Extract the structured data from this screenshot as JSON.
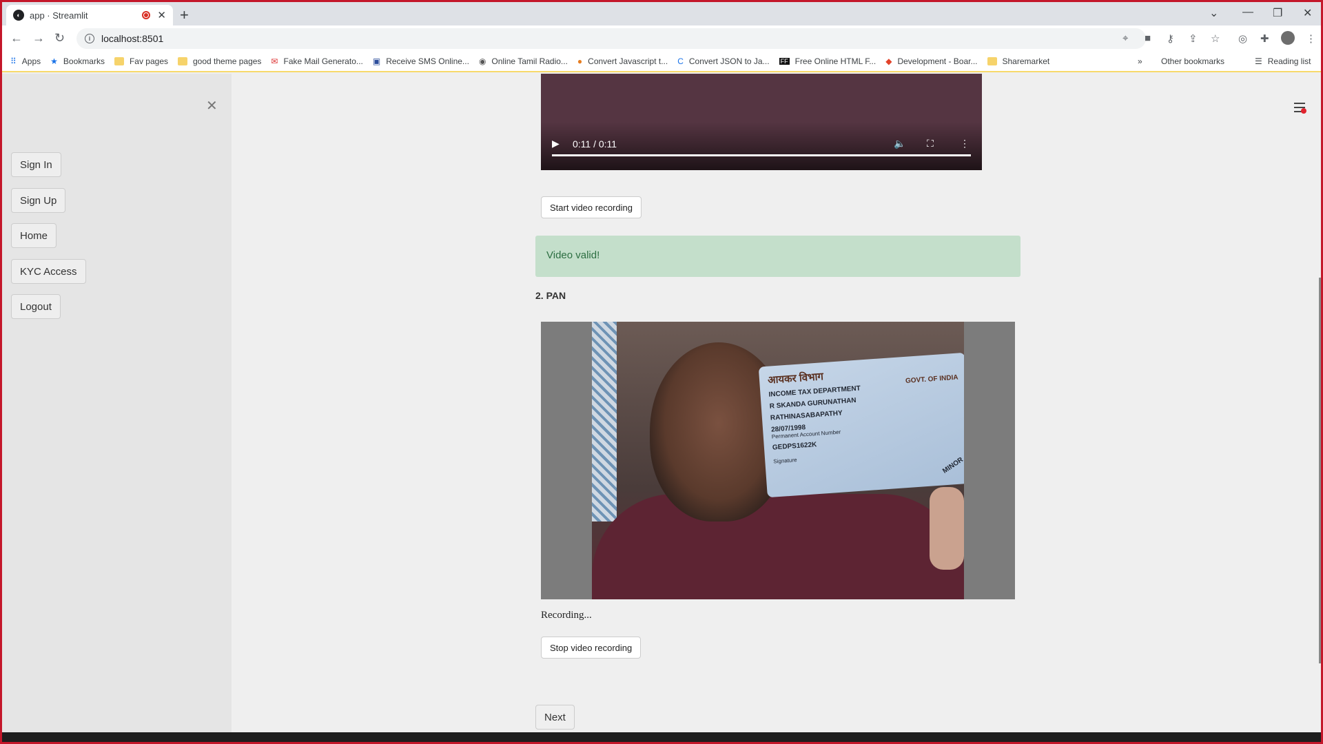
{
  "browser": {
    "tab_title": "app · Streamlit",
    "url": "localhost:8501",
    "bookmarks": [
      "Apps",
      "Bookmarks",
      "Fav pages",
      "good theme pages",
      "Fake Mail Generato...",
      "Receive SMS Online...",
      "Online Tamil Radio...",
      "Convert Javascript t...",
      "Convert JSON to Ja...",
      "Free Online HTML F...",
      "Development - Boar...",
      "Sharemarket"
    ],
    "bookmarks_overflow": "»",
    "other_bookmarks": "Other bookmarks",
    "reading_list": "Reading list"
  },
  "sidebar": {
    "close_glyph": "✕",
    "items": [
      "Sign In",
      "Sign Up",
      "Home",
      "KYC Access",
      "Logout"
    ]
  },
  "video_player": {
    "time": "0:11 / 0:11",
    "progress": 1.0
  },
  "main": {
    "start_button": "Start video recording",
    "success_message": "Video valid!",
    "section_title": "2. PAN",
    "recording_status": "Recording...",
    "stop_button": "Stop video recording",
    "next_button": "Next"
  },
  "pan_card": {
    "header_hindi": "आयकर विभाग",
    "header": "INCOME TAX DEPARTMENT",
    "govt": "GOVT. OF INDIA",
    "name": "R SKANDA GURUNATHAN",
    "father_name": "RATHINASABAPATHY",
    "dob": "28/07/1998",
    "pan_label": "Permanent Account Number",
    "pan_number": "GEDPS1622K",
    "signature_label": "Signature",
    "minor": "MINOR"
  }
}
